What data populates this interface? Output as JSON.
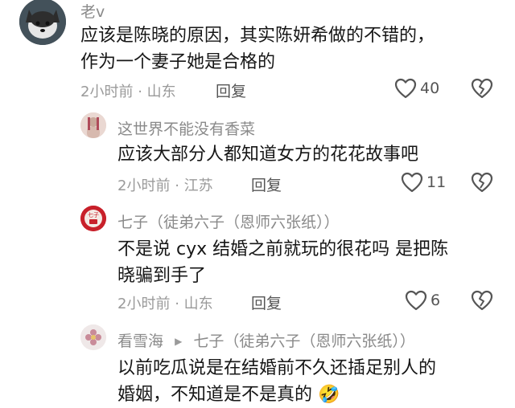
{
  "comments": [
    {
      "name": "老v",
      "text_lines": [
        "应该是陈晓的原因，其实陈妍希做的不错的，",
        "作为一个妻子她是合格的"
      ],
      "time": "2小时前",
      "location": "山东",
      "reply_label": "回复",
      "likes": "40"
    },
    {
      "name": "这世界不能没有香菜",
      "text_lines": [
        "应该大部分人都知道女方的花花故事吧"
      ],
      "time": "2小时前",
      "location": "江苏",
      "reply_label": "回复",
      "likes": "11"
    },
    {
      "name": "七子（徒弟六子（恩师六张纸））",
      "avatar_text": "七子",
      "text_lines": [
        "不是说 cyx 结婚之前就玩的很花吗 是把陈",
        "晓骗到手了"
      ],
      "time": "2小时前",
      "location": "山东",
      "reply_label": "回复",
      "likes": "6"
    },
    {
      "name": "看雪海",
      "reply_to": "七子（徒弟六子（恩师六张纸））",
      "text_lines": [
        "以前吃瓜说是在结婚前不久还插足别人的",
        "婚姻，不知道是不是真的"
      ],
      "emoji": "🤣"
    }
  ],
  "separator": "·",
  "icons": {
    "like": "heart-outline-icon",
    "dislike": "broken-heart-icon",
    "reply_arrow": "play-triangle-icon"
  }
}
